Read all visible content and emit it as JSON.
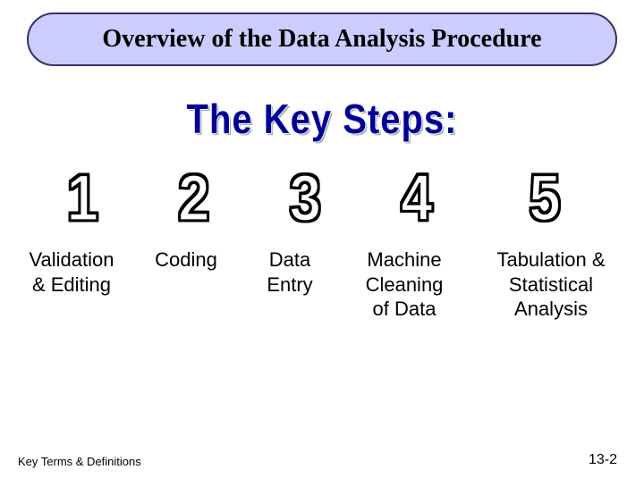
{
  "title": "Overview of the Data Analysis Procedure",
  "subtitle": "The Key Steps:",
  "steps": {
    "n1": "1",
    "n2": "2",
    "n3": "3",
    "n4": "4",
    "n5": "5",
    "label1a": "Validation",
    "label1b": "& Editing",
    "label2": "Coding",
    "label3a": "Data",
    "label3b": "Entry",
    "label4a": "Machine",
    "label4b": "Cleaning",
    "label4c": "of Data",
    "label5a": "Tabulation &",
    "label5b": "Statistical",
    "label5c": "Analysis"
  },
  "footer": {
    "left": "Key Terms & Definitions",
    "right": "13-2"
  }
}
